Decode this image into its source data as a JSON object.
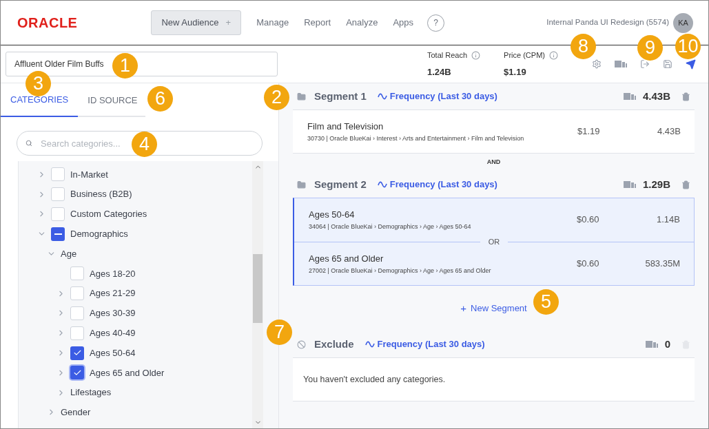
{
  "header": {
    "logo": "ORACLE",
    "new_button": "New Audience",
    "new_button_icon": "+",
    "nav": [
      "Manage",
      "Report",
      "Analyze",
      "Apps"
    ],
    "help": "?",
    "account": "Internal Panda UI Redesign (5574)",
    "avatar": "KA"
  },
  "toolbar": {
    "audience_name": "Affluent Older Film Buffs",
    "metrics": [
      {
        "label": "Total Reach",
        "value": "1.24B"
      },
      {
        "label": "Price (CPM)",
        "value": "$1.19"
      }
    ]
  },
  "tabs": [
    {
      "label": "CATEGORIES",
      "selected": true
    },
    {
      "label": "ID SOURCE",
      "selected": false
    }
  ],
  "search": {
    "placeholder": "Search categories..."
  },
  "tree": [
    {
      "label": "In-Market",
      "expanded": false,
      "checked": false,
      "indeterminate": false
    },
    {
      "label": "Business (B2B)",
      "expanded": false,
      "checked": false,
      "indeterminate": false
    },
    {
      "label": "Custom Categories",
      "expanded": false,
      "checked": false,
      "indeterminate": false
    },
    {
      "label": "Demographics",
      "expanded": true,
      "checked": true,
      "indeterminate": true,
      "children": [
        {
          "label": "Age",
          "expanded": true,
          "children": [
            {
              "label": "Ages 18-20",
              "checked": false,
              "indeterminate": false
            },
            {
              "label": "Ages 21-29",
              "expanded": false,
              "checked": false,
              "indeterminate": false
            },
            {
              "label": "Ages 30-39",
              "expanded": false,
              "checked": false,
              "indeterminate": false
            },
            {
              "label": "Ages 40-49",
              "expanded": false,
              "checked": false,
              "indeterminate": false
            },
            {
              "label": "Ages 50-64",
              "expanded": false,
              "checked": true,
              "indeterminate": false
            },
            {
              "label": "Ages 65 and Older",
              "expanded": false,
              "checked": true,
              "indeterminate": false,
              "focused": true
            },
            {
              "label": "Lifestages",
              "expanded": false
            }
          ]
        },
        {
          "label": "Gender",
          "expanded": false
        }
      ]
    }
  ],
  "segments": [
    {
      "title": "Segment 1",
      "frequency": "Frequency (Last 30 days)",
      "reach": "4.43B",
      "selected": false,
      "rows": [
        {
          "name": "Film and Television",
          "path": "30730 | Oracle BlueKai › Interest › Arts and Entertainment › Film and Television",
          "price": "$1.19",
          "reach": "4.43B"
        }
      ],
      "next_joiner": "AND"
    },
    {
      "title": "Segment 2",
      "frequency": "Frequency (Last 30 days)",
      "reach": "1.29B",
      "selected": true,
      "joiner": "OR",
      "rows": [
        {
          "name": "Ages 50-64",
          "path": "34064 | Oracle BlueKai › Demographics › Age › Ages 50-64",
          "price": "$0.60",
          "reach": "1.14B"
        },
        {
          "name": "Ages 65 and Older",
          "path": "27002 | Oracle BlueKai › Demographics › Age › Ages 65 and Older",
          "price": "$0.60",
          "reach": "583.35M"
        }
      ]
    }
  ],
  "new_segment": {
    "icon": "+",
    "label": "New Segment"
  },
  "exclude": {
    "kind": "exclude",
    "title": "Exclude",
    "frequency": "Frequency (Last 30 days)",
    "reach": "0",
    "empty": "You haven't excluded any categories."
  },
  "callouts": [
    "1",
    "2",
    "3",
    "4",
    "5",
    "6",
    "7",
    "8",
    "9",
    "10"
  ]
}
